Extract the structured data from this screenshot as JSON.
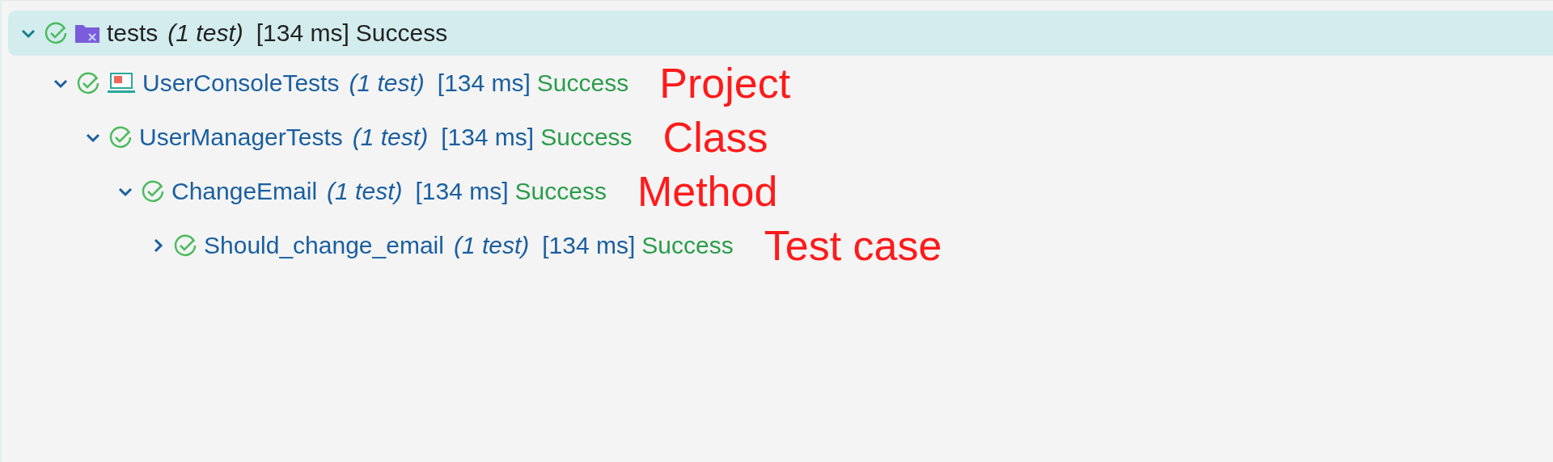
{
  "tree": [
    {
      "name": "tests",
      "count": "(1 test)",
      "duration": "[134 ms]",
      "status": "Success",
      "kind": "solution",
      "expanded": true,
      "selected": true,
      "children": [
        {
          "name": "UserConsoleTests",
          "count": "(1 test)",
          "duration": "[134 ms]",
          "status": "Success",
          "kind": "project",
          "expanded": true,
          "selected": false,
          "annotation": "Project",
          "children": [
            {
              "name": "UserManagerTests",
              "count": "(1 test)",
              "duration": "[134 ms]",
              "status": "Success",
              "expanded": true,
              "selected": false,
              "annotation": "Class",
              "children": [
                {
                  "name": "ChangeEmail",
                  "count": "(1 test)",
                  "duration": "[134 ms]",
                  "status": "Success",
                  "expanded": true,
                  "selected": false,
                  "annotation": "Method",
                  "children": [
                    {
                      "name": "Should_change_email",
                      "count": "(1 test)",
                      "duration": "[134 ms]",
                      "status": "Success",
                      "expanded": false,
                      "selected": false,
                      "annotation": "Test case"
                    }
                  ]
                }
              ]
            }
          ]
        }
      ]
    }
  ]
}
